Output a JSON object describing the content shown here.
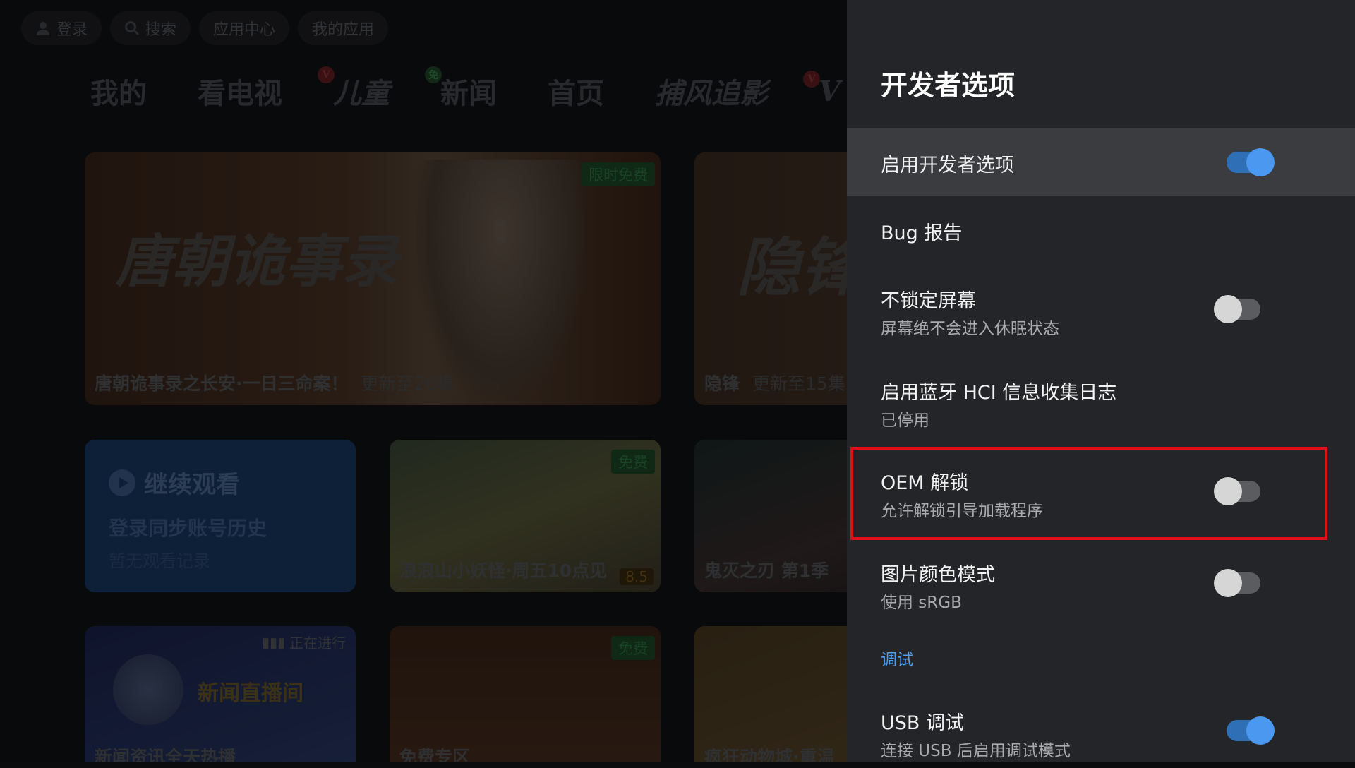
{
  "background": {
    "topbar": [
      {
        "label": "登录",
        "icon": "user-icon"
      },
      {
        "label": "搜索",
        "icon": "search-icon"
      },
      {
        "label": "应用中心"
      },
      {
        "label": "我的应用"
      }
    ],
    "nav": [
      "我的",
      "看电视",
      "儿童",
      "新闻",
      "首页",
      "捕风追影",
      "V"
    ],
    "cards": {
      "hero1": {
        "poster": "唐朝诡事录",
        "caption": "唐朝诡事录之长安·一日三命案！",
        "sub": "更新至26集",
        "tag": "限时免费"
      },
      "hero2": {
        "poster": "隐锋",
        "caption": "隐锋",
        "sub": "更新至15集"
      },
      "continue": {
        "title": "继续观看",
        "line1": "登录同步账号历史",
        "line2": "暂无观看记录"
      },
      "mid1": {
        "caption": "浪浪山小妖怪·周五10点见",
        "tag": "免费",
        "score": "8.5"
      },
      "mid2": {
        "caption": "鬼灭之刃 第1季"
      },
      "news": {
        "caption": "新闻资讯全天热播",
        "live": "正在进行",
        "logo": "新闻直播间"
      },
      "free": {
        "caption": "免费专区",
        "tag": "免费"
      },
      "zoo": {
        "caption": "疯狂动物城·重温"
      }
    }
  },
  "panel": {
    "title": "开发者选项",
    "rows": [
      {
        "label": "启用开发者选项",
        "toggle": "on"
      },
      {
        "label": "Bug 报告"
      },
      {
        "label": "不锁定屏幕",
        "sublabel": "屏幕绝不会进入休眠状态",
        "toggle": "off"
      },
      {
        "label": "启用蓝牙 HCI 信息收集日志",
        "sublabel": "已停用"
      },
      {
        "label": "OEM 解锁",
        "sublabel": "允许解锁引导加载程序",
        "toggle": "off"
      },
      {
        "label": "图片颜色模式",
        "sublabel": "使用 sRGB",
        "toggle": "off"
      }
    ],
    "section": "调试",
    "debug_rows": [
      {
        "label": "USB 调试",
        "sublabel": "连接 USB 后启用调试模式",
        "toggle": "on"
      }
    ]
  },
  "colors": {
    "accent": "#4a98f0",
    "highlight": "#e0101b",
    "panel": "#242528"
  }
}
